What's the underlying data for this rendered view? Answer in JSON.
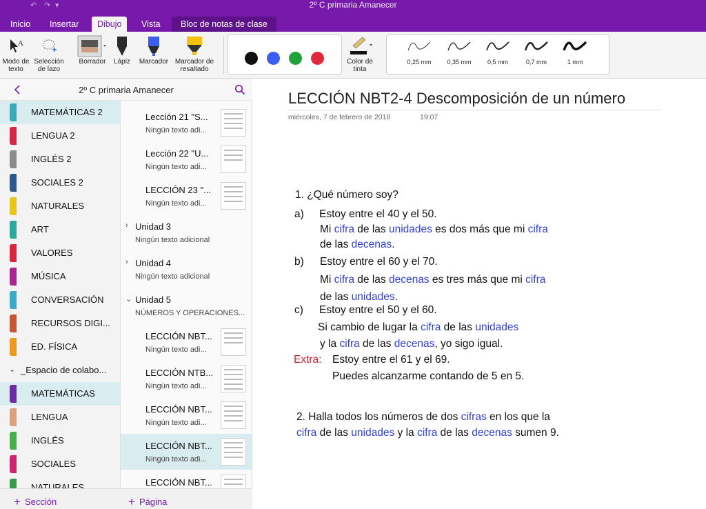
{
  "window": {
    "title": "2º C primaria Amanecer",
    "quick_access": {
      "undo": "↶",
      "redo": "↷",
      "customize": "▾"
    }
  },
  "tabs": [
    {
      "label": "Inicio"
    },
    {
      "label": "Insertar"
    },
    {
      "label": "Dibujo"
    },
    {
      "label": "Vista"
    },
    {
      "label": "Bloc de notas de clase"
    }
  ],
  "ribbon": {
    "text_mode": "Modo de texto",
    "lasso": "Selección de lazo",
    "eraser": "Borrador",
    "pencil": "Lápiz",
    "marker": "Marcador",
    "highlighter": "Marcador de resaltado",
    "ink_color": "Color de tinta",
    "colors": [
      "#111111",
      "#3d5cf2",
      "#22a23a",
      "#e0283c"
    ],
    "pens": [
      "0,25 mm",
      "0,35 mm",
      "0,5 mm",
      "0,7 mm",
      "1 mm"
    ]
  },
  "nav": {
    "notebook_title": "2º C primaria Amanecer",
    "back_icon": "chevron-left-icon",
    "search_icon": "search-icon",
    "add_section": "Sección",
    "add_page": "Página"
  },
  "sections": [
    {
      "label": "MATEMÁTICAS 2",
      "color": "#3fa9b5"
    },
    {
      "label": "LENGUA 2",
      "color": "#d5264c"
    },
    {
      "label": "INGLÉS 2",
      "color": "#8c8c8c"
    },
    {
      "label": "SOCIALES 2",
      "color": "#2d5a8a"
    },
    {
      "label": "NATURALES",
      "color": "#e8c51b"
    },
    {
      "label": "ART",
      "color": "#2ea89c"
    },
    {
      "label": "VALORES",
      "color": "#d6283d"
    },
    {
      "label": "MÚSICA",
      "color": "#a7278f"
    },
    {
      "label": "CONVERSACIÓN",
      "color": "#3fa9c9"
    },
    {
      "label": "RECURSOS DIGI...",
      "color": "#c85634"
    },
    {
      "label": "ED. FÍSICA",
      "color": "#ec9a1d"
    },
    {
      "label": "_Espacio de colabo...",
      "color": ""
    },
    {
      "label": "MATEMÁTICAS",
      "color": "#6a2ea0"
    },
    {
      "label": "LENGUA",
      "color": "#d8a27d"
    },
    {
      "label": "INGLÉS",
      "color": "#4bae4a"
    },
    {
      "label": "SOCIALES",
      "color": "#cc2670"
    },
    {
      "label": "NATURALES",
      "color": "#3a9a4a"
    }
  ],
  "pages": [
    {
      "title": "Lección 21 \"S...",
      "subtitle": "Ningún texto adi..."
    },
    {
      "title": "Lección 22 \"U...",
      "subtitle": "Ningún texto adi..."
    },
    {
      "title": "LECCIÓN 23 \"...",
      "subtitle": "Ningún texto adi..."
    },
    {
      "title": "Unidad 3",
      "subtitle": "Ningún texto adicional"
    },
    {
      "title": "Unidad 4",
      "subtitle": "Ningún texto adicional"
    },
    {
      "title": "Unidad 5",
      "subtitle": "NÚMEROS Y OPERACIONES..."
    },
    {
      "title": "LECCIÓN NBT...",
      "subtitle": "Ningún texto adi..."
    },
    {
      "title": "LECCIÓN NTB...",
      "subtitle": "Ningún texto adi..."
    },
    {
      "title": "LECCIÓN NBT...",
      "subtitle": "Ningún texto adi..."
    },
    {
      "title": "LECCIÓN NBT...",
      "subtitle": "Ningún texto adi..."
    },
    {
      "title": "LECCIÓN NBT...",
      "subtitle": ""
    }
  ],
  "page": {
    "title": "LECCIÓN NBT2-4 Descomposición de un número",
    "date": "miércoles, 7 de febrero de 2018",
    "time": "19:07",
    "q1": "1. ¿Qué número soy?",
    "a": {
      "marker": "a)",
      "line1": "Estoy entre el 40 y el 50.",
      "l2": [
        "Mi ",
        "cifra",
        " de las ",
        "unidades",
        " es dos más que mi ",
        "cifra"
      ],
      "l3": [
        "de las ",
        "decenas",
        "."
      ]
    },
    "b": {
      "marker": "b)",
      "line1": "Estoy entre el 60 y el 70.",
      "l2": [
        "Mi ",
        "cifra",
        " de las ",
        "decenas",
        " es tres más que mi ",
        "cifra"
      ],
      "l3": [
        "de las ",
        "unidades",
        "."
      ]
    },
    "c": {
      "marker": "c)",
      "line1": "Estoy entre el 50 y el 60.",
      "l2": [
        "Si cambio de lugar la ",
        "cifra",
        " de las ",
        "unidades"
      ],
      "l3": [
        "y la ",
        "cifra",
        " de las ",
        "decenas",
        ", yo sigo igual."
      ]
    },
    "extra": {
      "marker": "Extra:",
      "line1": "Estoy entre el 61 y el 69.",
      "line2": "Puedes alcanzarme contando de 5 en 5."
    },
    "q2": {
      "l1": [
        "2. Halla todos los números de dos ",
        "cifras",
        " en los que la"
      ],
      "l2": [
        "cifra",
        " de las ",
        "unidades",
        " y la ",
        "cifra",
        " de las ",
        "decenas",
        " sumen 9."
      ]
    }
  }
}
